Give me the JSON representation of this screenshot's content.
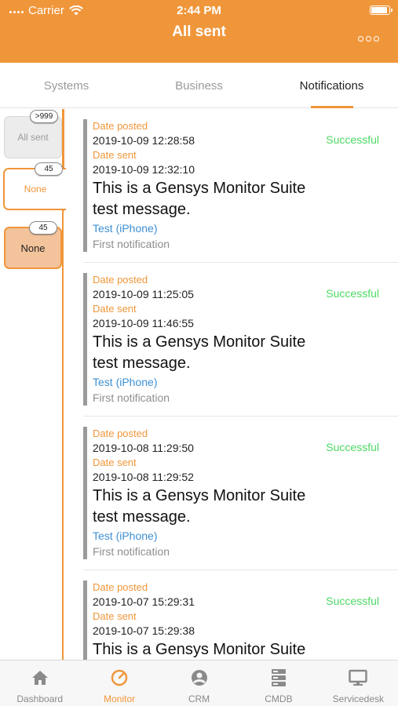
{
  "status_bar": {
    "carrier": "Carrier",
    "time": "2:44 PM",
    "battery_level": 0.95
  },
  "header": {
    "title": "All sent"
  },
  "tabs": [
    {
      "label": "Systems"
    },
    {
      "label": "Business"
    },
    {
      "label": "Notifications",
      "active": true
    }
  ],
  "filters": [
    {
      "label": "All sent",
      "count": ">999"
    },
    {
      "label": "None",
      "count": "45"
    },
    {
      "label": "None",
      "count": "45"
    }
  ],
  "notifications": [
    {
      "date_posted_label": "Date posted",
      "date_posted": "2019-10-09 12:28:58",
      "date_sent_label": "Date sent",
      "date_sent": "2019-10-09 12:32:10",
      "message": "This is a Gensys Monitor Suite test message.",
      "recipient": "Test (iPhone)",
      "note": "First notification",
      "status": "Successful"
    },
    {
      "date_posted_label": "Date posted",
      "date_posted": "2019-10-09 11:25:05",
      "date_sent_label": "Date sent",
      "date_sent": "2019-10-09 11:46:55",
      "message": "This is a Gensys Monitor Suite test message.",
      "recipient": "Test (iPhone)",
      "note": "First notification",
      "status": "Successful"
    },
    {
      "date_posted_label": "Date posted",
      "date_posted": "2019-10-08 11:29:50",
      "date_sent_label": "Date sent",
      "date_sent": "2019-10-08 11:29:52",
      "message": "This is a Gensys Monitor Suite test message.",
      "recipient": "Test (iPhone)",
      "note": "First notification",
      "status": "Successful"
    },
    {
      "date_posted_label": "Date posted",
      "date_posted": "2019-10-07 15:29:31",
      "date_sent_label": "Date sent",
      "date_sent": "2019-10-07 15:29:38",
      "message": "This is a Gensys Monitor Suite test message.",
      "recipient": "",
      "note": "",
      "status": "Successful"
    }
  ],
  "bottom_nav": [
    {
      "label": "Dashboard",
      "icon": "home-icon"
    },
    {
      "label": "Monitor",
      "icon": "gauge-icon",
      "active": true
    },
    {
      "label": "CRM",
      "icon": "person-icon"
    },
    {
      "label": "CMDB",
      "icon": "server-icon"
    },
    {
      "label": "Servicedesk",
      "icon": "monitor-icon"
    }
  ],
  "colors": {
    "accent": "#f0963a",
    "success": "#4cd964",
    "link": "#3d8fd4",
    "inactive": "#8a8a8a"
  }
}
